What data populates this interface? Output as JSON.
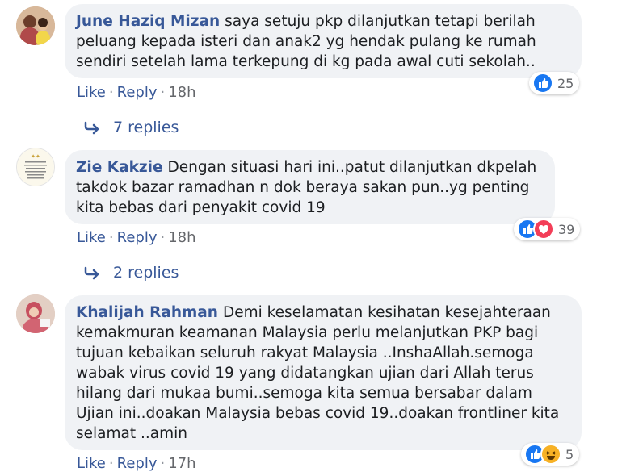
{
  "comments": [
    {
      "author": "June Haziq Mizan",
      "text": "saya setuju pkp dilanjutkan tetapi berilah peluang kepada isteri dan anak2 yg hendak pulang ke rumah sendiri setelah lama terkepung di kg pada awal cuti sekolah..",
      "reaction_count": "25",
      "reaction_icons": [
        "like-icon"
      ],
      "like_label": "Like",
      "reply_label": "Reply",
      "time": "18h",
      "replies_label": "7 replies"
    },
    {
      "author": "Zie Kakzie",
      "text": "Dengan situasi hari ini..patut dilanjutkan dkpelah takdok bazar ramadhan n dok beraya sakan pun..yg penting kita bebas dari penyakit covid 19",
      "reaction_count": "39",
      "reaction_icons": [
        "like-icon",
        "love-icon"
      ],
      "like_label": "Like",
      "reply_label": "Reply",
      "time": "18h",
      "replies_label": "2 replies"
    },
    {
      "author": "Khalijah Rahman",
      "text": "Demi keselamatan kesihatan kesejahteraan kemakmuran keamanan Malaysia perlu melanjutkan PKP bagi tujuan kebaikan seluruh rakyat Malaysia ..InshaAllah.semoga wabak virus covid 19 yang didatangkan ujian dari Allah terus hilang dari mukaa bumi..semoga kita semua bersabar dalam Ujian ini..doakan Malaysia bebas covid 19..doakan frontliner kita selamat ..amin",
      "reaction_count": "5",
      "reaction_icons": [
        "like-icon",
        "haha-icon"
      ],
      "like_label": "Like",
      "reply_label": "Reply",
      "time": "17h"
    }
  ],
  "separator": "·",
  "colors": {
    "author": "#385898",
    "bubble": "#f0f2f5",
    "meta": "#65676b",
    "like": "#1877f2",
    "love": "#f33e58",
    "haha": "#f7b125"
  }
}
